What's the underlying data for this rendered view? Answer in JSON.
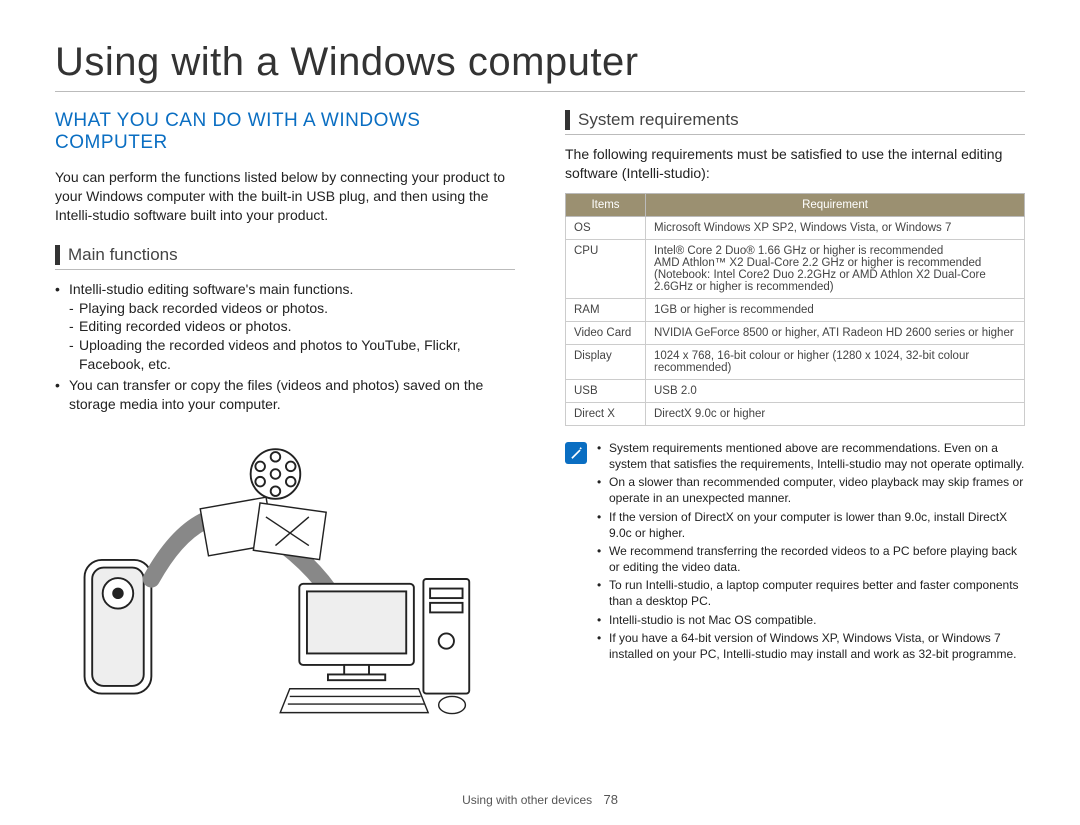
{
  "page_title": "Using with a Windows computer",
  "left": {
    "section_title": "WHAT YOU CAN DO WITH A WINDOWS COMPUTER",
    "intro": "You can perform the functions listed below by connecting your product to your Windows computer with the built-in USB plug, and then using the Intelli-studio software built into your product.",
    "sub_heading": "Main functions",
    "bullet1": "Intelli-studio editing software's main functions.",
    "sub1": "Playing back recorded videos or photos.",
    "sub2": "Editing recorded videos or photos.",
    "sub3": "Uploading the recorded videos and photos to YouTube, Flickr, Facebook, etc.",
    "bullet2": "You can transfer or copy the files (videos and photos) saved on the storage media into your computer."
  },
  "right": {
    "sub_heading": "System requirements",
    "intro": "The following requirements must be satisfied to use the internal editing software (Intelli-studio):",
    "table": {
      "headers": [
        "Items",
        "Requirement"
      ],
      "rows": [
        [
          "OS",
          "Microsoft Windows XP SP2, Windows Vista, or Windows 7"
        ],
        [
          "CPU",
          "Intel® Core 2 Duo® 1.66 GHz or higher is recommended\nAMD Athlon™ X2 Dual-Core 2.2 GHz or higher is recommended\n(Notebook: Intel Core2 Duo 2.2GHz or AMD Athlon X2 Dual-Core 2.6GHz or higher is recommended)"
        ],
        [
          "RAM",
          "1GB or higher is recommended"
        ],
        [
          "Video Card",
          "NVIDIA GeForce 8500 or higher, ATI Radeon HD 2600 series or higher"
        ],
        [
          "Display",
          "1024 x 768, 16-bit colour or higher (1280 x 1024, 32-bit colour recommended)"
        ],
        [
          "USB",
          "USB 2.0"
        ],
        [
          "Direct X",
          "DirectX 9.0c or higher"
        ]
      ]
    },
    "notes": [
      "System requirements mentioned above are recommendations. Even on a system that satisfies the requirements, Intelli-studio may not operate optimally.",
      "On a slower than recommended computer, video playback may skip frames or operate in an unexpected manner.",
      "If the version of DirectX on your computer is lower than 9.0c, install DirectX 9.0c or higher.",
      "We recommend transferring the recorded videos to a PC before playing back or editing the video data.",
      "To run Intelli-studio, a laptop computer requires better and faster components than a desktop PC.",
      "Intelli-studio is not Mac OS compatible.",
      "If you have a 64-bit version of Windows XP, Windows Vista, or Windows 7 installed on your PC, Intelli-studio may install and work as 32-bit programme."
    ]
  },
  "footer": {
    "section": "Using with other devices",
    "page": "78"
  }
}
